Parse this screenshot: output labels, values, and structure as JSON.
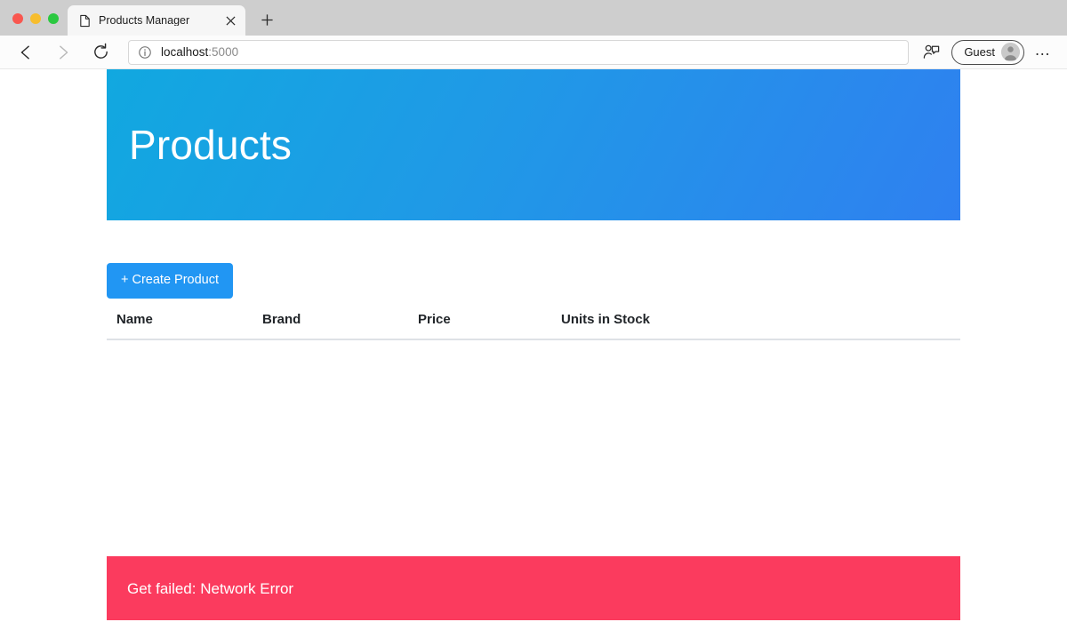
{
  "browser": {
    "window_controls": {
      "close": "close",
      "minimize": "minimize",
      "maximize": "maximize"
    },
    "tab": {
      "title": "Products Manager",
      "favicon": "page-icon",
      "close_label": "×"
    },
    "new_tab_label": "+",
    "nav": {
      "back_label": "←",
      "forward_label": "→",
      "reload_label": "↻"
    },
    "address": {
      "security_icon": "info-icon",
      "host": "localhost",
      "port": ":5000",
      "full_url": "localhost:5000"
    },
    "share_icon": "share-profile-icon",
    "profile": {
      "name": "Guest",
      "avatar_icon": "person-avatar-icon"
    },
    "menu_label": "…"
  },
  "page": {
    "jumbotron": {
      "title": "Products",
      "gradient_start": "#11a8e0",
      "gradient_end": "#2f80f0"
    },
    "create_button": {
      "label": "+ Create Product",
      "color": "#2196f3"
    },
    "table": {
      "columns": [
        {
          "label": "Name"
        },
        {
          "label": "Brand"
        },
        {
          "label": "Price"
        },
        {
          "label": "Units in Stock"
        }
      ],
      "rows": []
    },
    "alert": {
      "message": "Get failed: Network Error",
      "color": "#fb3b5e"
    }
  }
}
